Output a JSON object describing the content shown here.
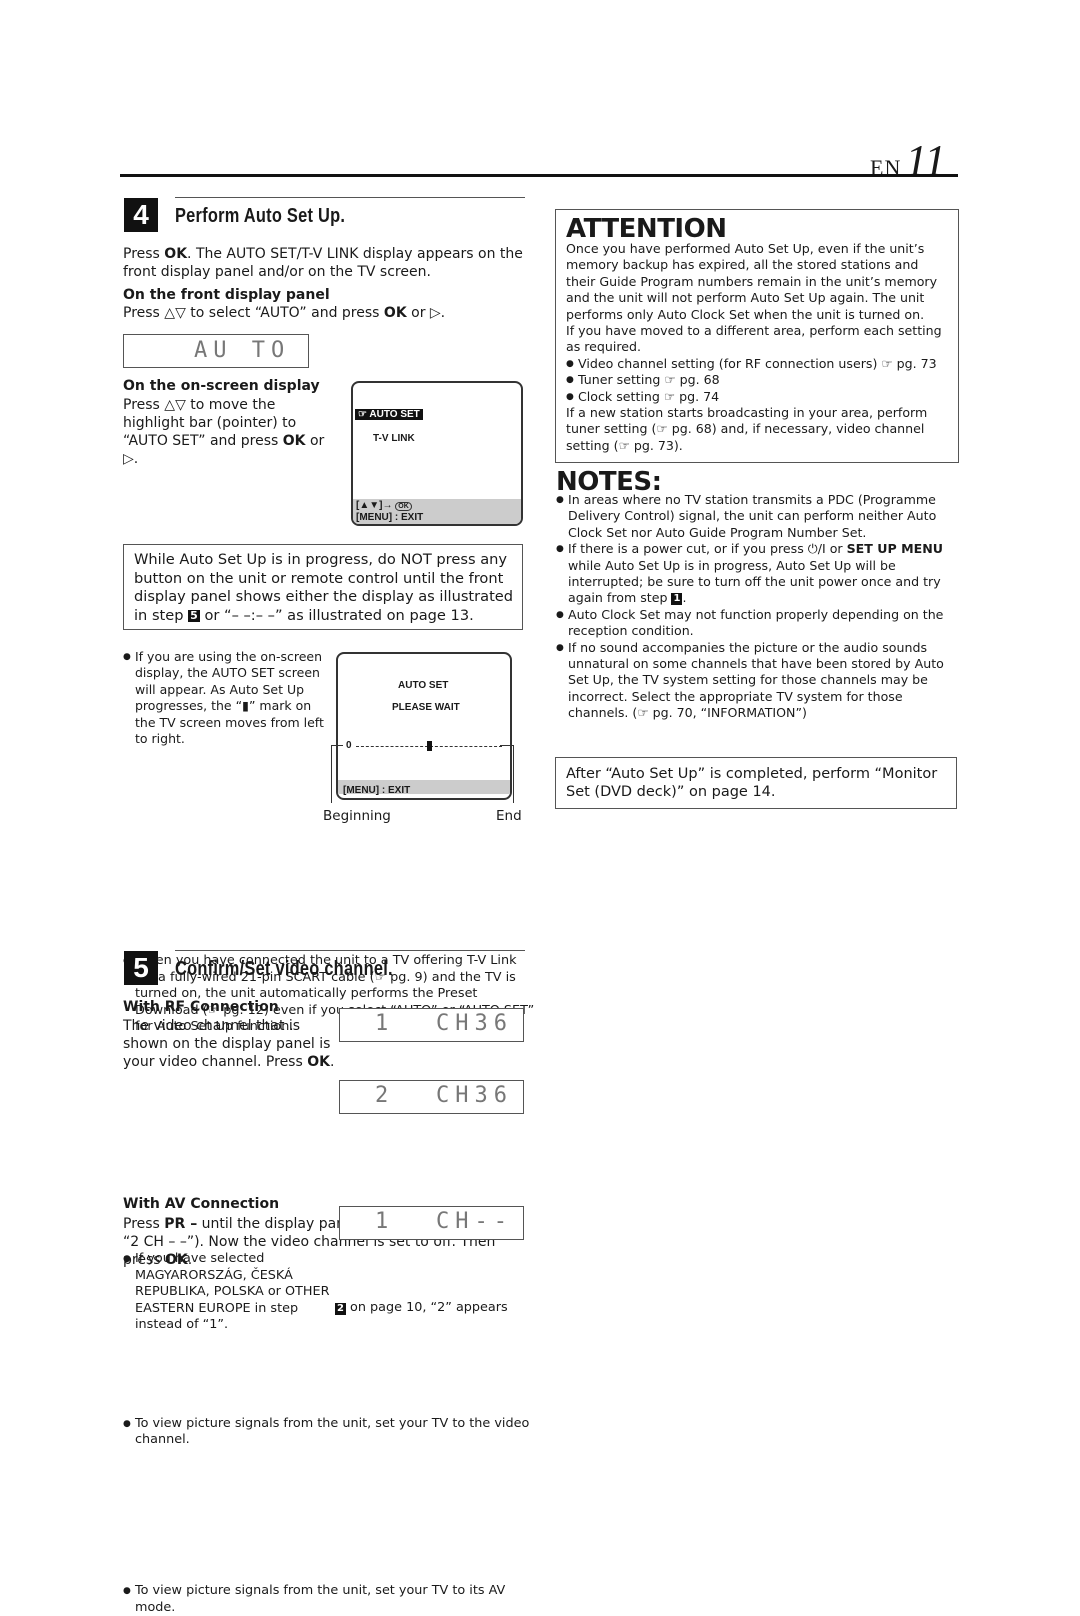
{
  "header": {
    "lang": "EN",
    "page_number": "11"
  },
  "step4": {
    "number": "4",
    "title": "Perform Auto Set Up.",
    "intro_bold": "OK",
    "intro_pre": "Press ",
    "intro_post": ". The AUTO SET/T-V LINK display appears on the front display panel and/or on the TV screen.",
    "front_panel": {
      "heading": "On the front display panel",
      "text_pre": "Press △▽ to select “AUTO” and press ",
      "text_bold": "OK",
      "text_post": " or ▷.",
      "lcd": "AU TO"
    },
    "onscreen": {
      "heading": "On the on-screen display",
      "text_pre": "Press △▽ to move the highlight bar (pointer) to “AUTO SET” and press ",
      "text_bold": "OK",
      "text_post": " or ▷.",
      "osd": {
        "selected_item": "AUTO SET",
        "item2": "T-V LINK",
        "nav_hint": "[▲▼]→",
        "ok_label": "OK",
        "exit_hint": "[MENU] : EXIT"
      }
    },
    "warning_box": {
      "text_pre": "While Auto Set Up is in progress, do NOT press any button on the unit or remote control until the front display panel shows either the display as illustrated in step ",
      "step_ref": "5",
      "text_post": " or “– –:– –” as illustrated on page 13."
    },
    "progress_note": "If you are using the on-screen display, the AUTO SET screen will appear. As Auto Set Up progresses, the “▮” mark on the TV screen moves from left to right.",
    "progress_osd": {
      "title": "AUTO SET",
      "status": "PLEASE WAIT",
      "scale_start": "0",
      "progress_fraction": 0.5,
      "exit_hint": "[MENU] : EXIT",
      "label_begin": "Beginning",
      "label_end": "End"
    },
    "tvlink_note": "When you have connected the unit to a TV offering T-V Link via a fully-wired 21-pin SCART cable (☞ pg. 9) and the TV is turned on, the unit automatically performs the Preset Download (☞ pg. 12) even if you select “AUTO” or “AUTO SET” for Auto Set Up function."
  },
  "step5": {
    "number": "5",
    "title": "Confirm/Set video channel.",
    "rf": {
      "heading": "With RF Connection",
      "text_pre": "The video channel that is shown on the display panel is your video channel. Press ",
      "text_bold": "OK",
      "text_post": ".",
      "lcd1_left": "1",
      "lcd1_right": "CH36",
      "lcd2_left": "2",
      "lcd2_right": "CH36",
      "bullet1_pre": "If you have selected MAGYARORSZÁG, ČESKÁ REPUBLIKA, POLSKA or OTHER EASTERN EUROPE in step ",
      "bullet1_ref": "2",
      "bullet1_post": " on page 10, “2” appears instead of “1”.",
      "bullet2": "To view picture signals from the unit, set your TV to the video channel."
    },
    "av": {
      "heading": "With AV Connection",
      "text_pre": "Press ",
      "text_bold1": "PR –",
      "text_mid": " until the display panel shows “1 CH – –” (or “2 CH – –”). Now the video channel is set to off. Then press ",
      "text_bold2": "OK",
      "text_post": ".",
      "lcd_left": "1",
      "lcd_right": "CH--",
      "bullet": "To view picture signals from the unit, set your TV to its AV mode."
    }
  },
  "attention": {
    "title": "ATTENTION",
    "para1": "Once you have performed Auto Set Up, even if the unit’s memory backup has expired, all the stored stations and their Guide Program numbers remain in the unit’s memory and the unit will not perform Auto Set Up again. The unit performs only Auto Clock Set when the unit is turned on.",
    "para2": "If you have moved to a different area, perform each setting as required.",
    "items": [
      "Video channel setting (for RF connection users) ☞ pg. 73",
      "Tuner setting ☞ pg. 68",
      "Clock setting ☞ pg. 74"
    ],
    "para3": "If a new station starts broadcasting in your area, perform tuner setting (☞ pg. 68) and, if necessary, video channel setting (☞ pg. 73)."
  },
  "notes": {
    "title": "NOTES:",
    "n1": "In areas where no TV station transmits a PDC (Programme Delivery Control) signal, the unit can perform neither Auto Clock Set nor Auto Guide Program Number Set.",
    "n2_pre": "If there is a power cut, or if you press ⏻/I or ",
    "n2_bold": "SET UP MENU",
    "n2_mid": " while Auto Set Up is in progress, Auto Set Up will be interrupted; be sure to turn off the unit power once and try again from step ",
    "n2_ref": "1",
    "n2_post": ".",
    "n3": "Auto Clock Set may not function properly depending on the reception condition.",
    "n4": "If no sound accompanies the picture or the audio sounds unnatural on some channels that have been stored by Auto Set Up, the TV system setting for those channels may be incorrect. Select the appropriate TV system for those channels. (☞ pg. 70, “INFORMATION”)"
  },
  "after_box": "After “Auto Set Up” is completed, perform “Monitor Set (DVD deck)” on page 14."
}
